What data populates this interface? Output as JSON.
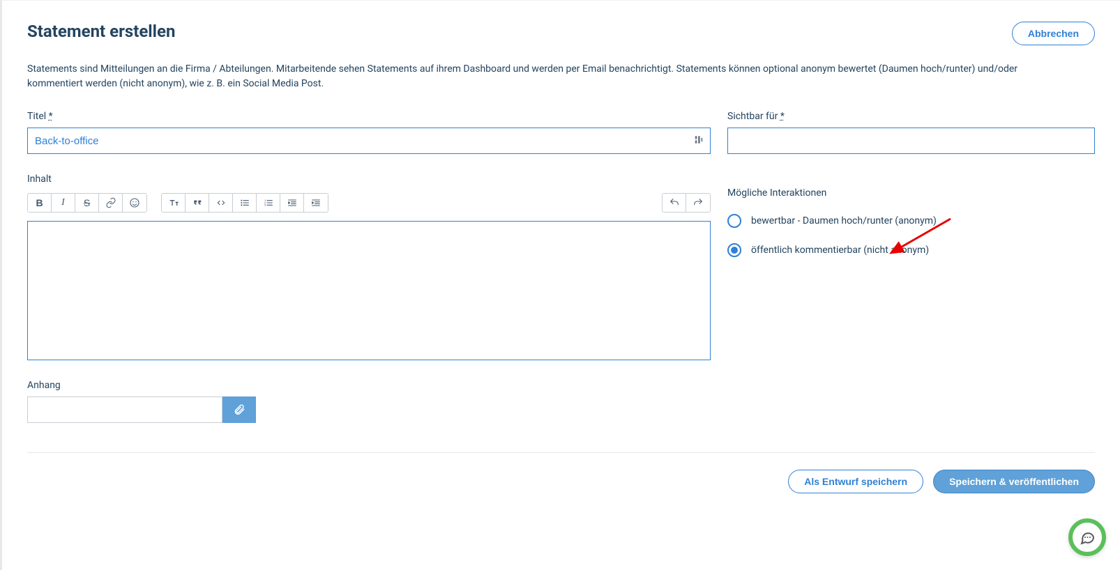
{
  "header": {
    "title": "Statement erstellen",
    "cancel": "Abbrechen"
  },
  "description": "Statements sind Mitteilungen an die Firma / Abteilungen. Mitarbeitende sehen Statements auf ihrem Dashboard und werden per Email benachrichtigt. Statements können optional anonym bewertet (Daumen hoch/runter) und/oder kommentiert werden (nicht anonym), wie z. B. ein Social Media Post.",
  "fields": {
    "title_label": "Titel ",
    "title_req": "*",
    "title_value": "Back-to-office",
    "visible_label": "Sichtbar für ",
    "visible_req": "*",
    "content_label": "Inhalt",
    "attachment_label": "Anhang",
    "interactions_label": "Mögliche Interaktionen"
  },
  "toolbar": {
    "bold": "B",
    "italic": "I",
    "strike": "S",
    "link": "link",
    "emoji": "emoji",
    "textsize": "textsize",
    "quote": "quote",
    "code": "code",
    "ul": "ul",
    "ol": "ol",
    "outdent": "outdent",
    "indent": "indent",
    "undo": "undo",
    "redo": "redo"
  },
  "interactions": {
    "opt1": "bewertbar - Daumen hoch/runter (anonym)",
    "opt2": "öffentlich kommentierbar (nicht anonym)",
    "selected": 1
  },
  "footer": {
    "draft": "Als Entwurf speichern",
    "publish": "Speichern & veröffentlichen"
  }
}
